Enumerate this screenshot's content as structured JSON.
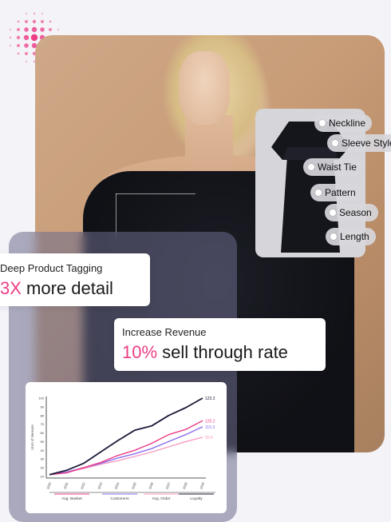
{
  "colors": {
    "accent": "#ec3d86",
    "navy": "#1b1b3a",
    "purple": "#8a6ef0",
    "pink": "#f36fa6",
    "magenta": "#ec3d86"
  },
  "tags": [
    {
      "label": "Neckline"
    },
    {
      "label": "Sleeve Style"
    },
    {
      "label": "Waist Tie"
    },
    {
      "label": "Pattern"
    },
    {
      "label": "Season"
    },
    {
      "label": "Length"
    }
  ],
  "stats": {
    "tagging": {
      "label": "Deep Product Tagging",
      "value_accent": "3X",
      "value_rest": " more detail"
    },
    "revenue": {
      "label": "Increase Revenue",
      "value_accent": "10%",
      "value_rest": " sell through rate"
    }
  },
  "chart_data": {
    "type": "line",
    "ylabel": "Units of Measure",
    "x": [
      "2010",
      "2011",
      "2012",
      "2013",
      "2014",
      "2015",
      "2016",
      "2017",
      "2018",
      "2019"
    ],
    "ylim": [
      10,
      100
    ],
    "yticks": [
      10,
      20,
      30,
      40,
      50,
      60,
      70,
      80,
      90,
      100
    ],
    "series": [
      {
        "name": "Loyalty",
        "color": "#1b1b3a",
        "values": [
          12,
          17,
          25,
          38,
          51,
          63,
          68,
          80,
          89,
          100
        ],
        "end_label": "123.2"
      },
      {
        "name": "Avg. Basket",
        "color": "#ec3d86",
        "values": [
          12,
          14,
          20,
          26,
          34,
          40,
          48,
          58,
          64,
          74
        ],
        "end_label": "125.2"
      },
      {
        "name": "Customers",
        "color": "#8a6ef0",
        "values": [
          12,
          15,
          20,
          25,
          31,
          36,
          42,
          50,
          58,
          67
        ],
        "end_label": "115.3"
      },
      {
        "name": "Avg. Order",
        "color": "#f79cc2",
        "values": [
          12,
          15,
          19,
          24,
          28,
          33,
          38,
          44,
          50,
          55
        ],
        "end_label": "90.6"
      }
    ],
    "legend": [
      "Avg. Basket",
      "Customers",
      "Avg. Order",
      "Loyalty"
    ],
    "legend_colors": [
      "#ec3d86",
      "#8a6ef0",
      "#f79cc2",
      "#1b1b3a"
    ]
  }
}
